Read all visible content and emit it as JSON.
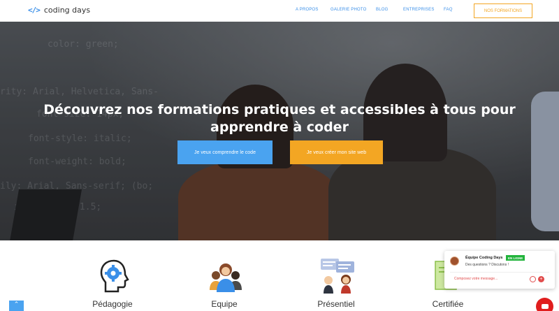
{
  "header": {
    "logo_mark": "</>",
    "logo_text": "coding days",
    "nav": [
      {
        "label": "A PROPOS"
      },
      {
        "label": "GALERIE PHOTO"
      },
      {
        "label": "BLOG"
      },
      {
        "label": "ENTREPRISES"
      },
      {
        "label": "FAQ"
      }
    ],
    "cta": "NOS FORMATIONS"
  },
  "hero": {
    "title_line1": "Découvrez nos formations pratiques et accessibles à tous pour",
    "title_line2": "apprendre à coder",
    "button_primary": "Je veux comprendre le code",
    "button_secondary": "Je veux créer mon site web",
    "background_code": [
      "color: green;",
      "rity: Arial, Helvetica, Sans-",
      "font-size: 14px;",
      "font-style: italic;",
      "font-weight: bold;",
      "ily: Arial, Sans-serif; (bo;",
      "ine-height: 1.5;"
    ]
  },
  "features": [
    {
      "label": "Pédagogie",
      "icon": "brain-gear-icon"
    },
    {
      "label": "Equipe",
      "icon": "team-icon"
    },
    {
      "label": "Présentiel",
      "icon": "people-chat-icon"
    },
    {
      "label": "Certifiée",
      "icon": "certificate-icon"
    }
  ],
  "chat": {
    "name": "Équipe Coding Days",
    "status": "EN LIGNE",
    "subtitle": "Des questions ? Discutons !",
    "placeholder": "Composez votre message..."
  },
  "colors": {
    "accent_blue": "#4aa3f0",
    "accent_orange": "#f3a623",
    "chat_red": "#e01d1d"
  }
}
